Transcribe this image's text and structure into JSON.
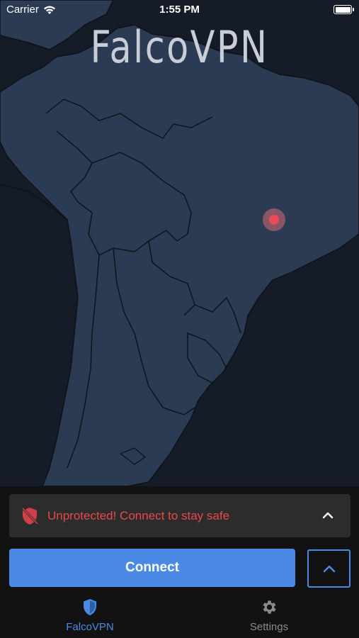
{
  "status_bar": {
    "carrier": "Carrier",
    "time": "1:55 PM",
    "battery_level": 1.0
  },
  "app": {
    "title": "FalcoVPN"
  },
  "map": {
    "region": "South America",
    "marker": "current-location"
  },
  "status_card": {
    "message": "Unprotected! Connect to stay safe",
    "color": "#e8484b"
  },
  "actions": {
    "connect_label": "Connect"
  },
  "tabs": [
    {
      "label": "FalcoVPN",
      "active": true
    },
    {
      "label": "Settings",
      "active": false
    }
  ],
  "colors": {
    "accent": "#4a8ae5",
    "danger": "#e8484b",
    "land": "#2b3b53",
    "ocean": "#161c27"
  }
}
